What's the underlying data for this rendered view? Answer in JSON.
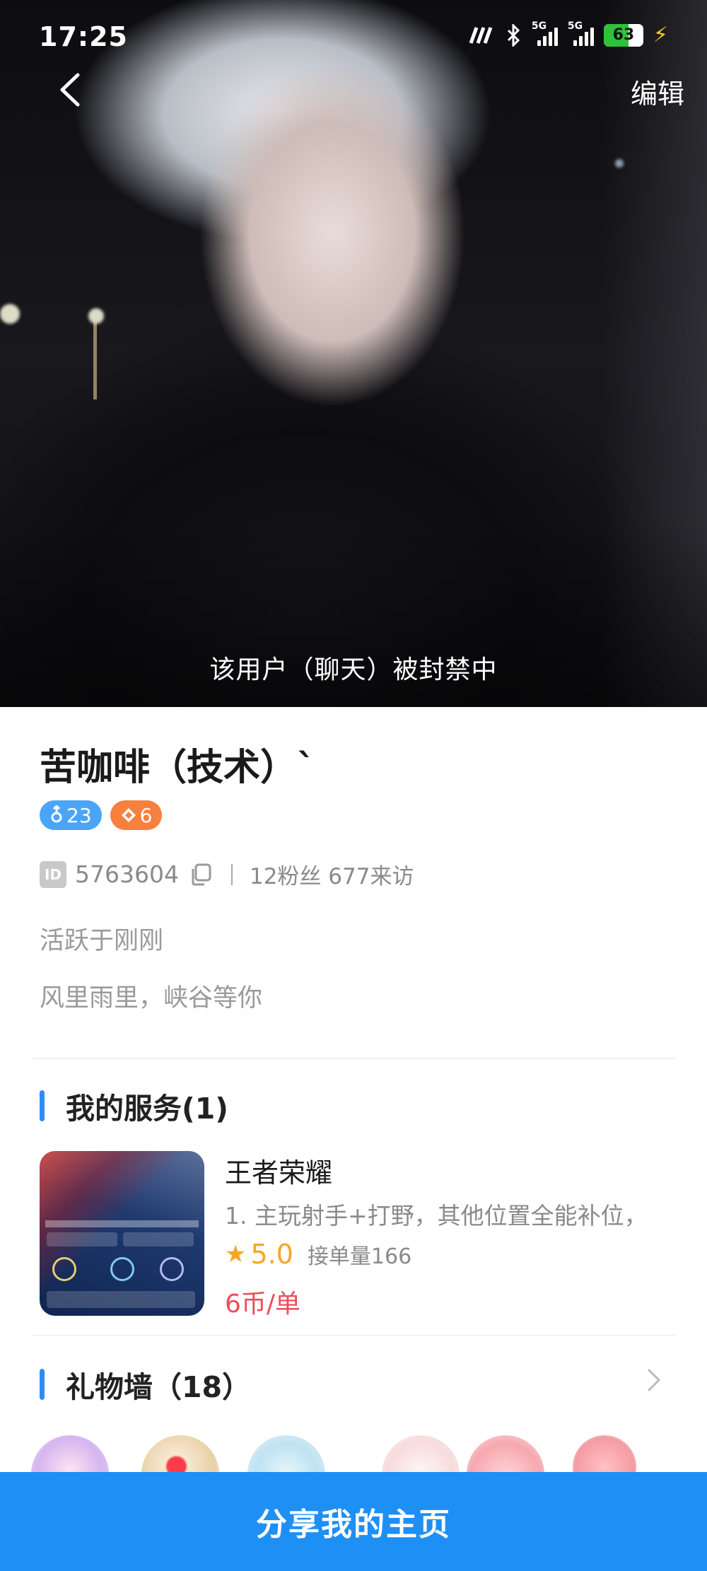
{
  "status_bar": {
    "time": "17:25",
    "network_1": "5G",
    "network_2": "5G",
    "battery": "63",
    "battery_level": 0.63
  },
  "header": {
    "edit_label": "编辑",
    "ban_notice": "该用户（聊天）被封禁中"
  },
  "profile": {
    "name": "苦咖啡（技术）`",
    "gender_badge": "23",
    "level_badge": "6",
    "id_chip": "ID",
    "id_number": "5763604",
    "stats": "12粉丝 677来访",
    "active_status": "活跃于刚刚",
    "bio": "风里雨里，峡谷等你"
  },
  "services": {
    "title": "我的服务(1)",
    "items": [
      {
        "game": "王者荣耀",
        "description": "1. 主玩射手+打野，其他位置全能补位，",
        "rating": "5.0",
        "orders": "接单量166",
        "price": "6币/单"
      }
    ]
  },
  "gift_wall": {
    "title": "礼物墙（18）"
  },
  "footer": {
    "share_label": "分享我的主页"
  },
  "colors": {
    "accent": "#1e8ff4",
    "section_bar": "#2f8bf5",
    "price": "#ef4b57",
    "rating": "#f6a623",
    "badge_blue": "#4aa5f8",
    "badge_orange": "#f7803e"
  },
  "icons": {
    "back": "chevron-left-icon",
    "copy": "copy-icon",
    "star": "star-icon",
    "more": "chevron-right-icon"
  }
}
